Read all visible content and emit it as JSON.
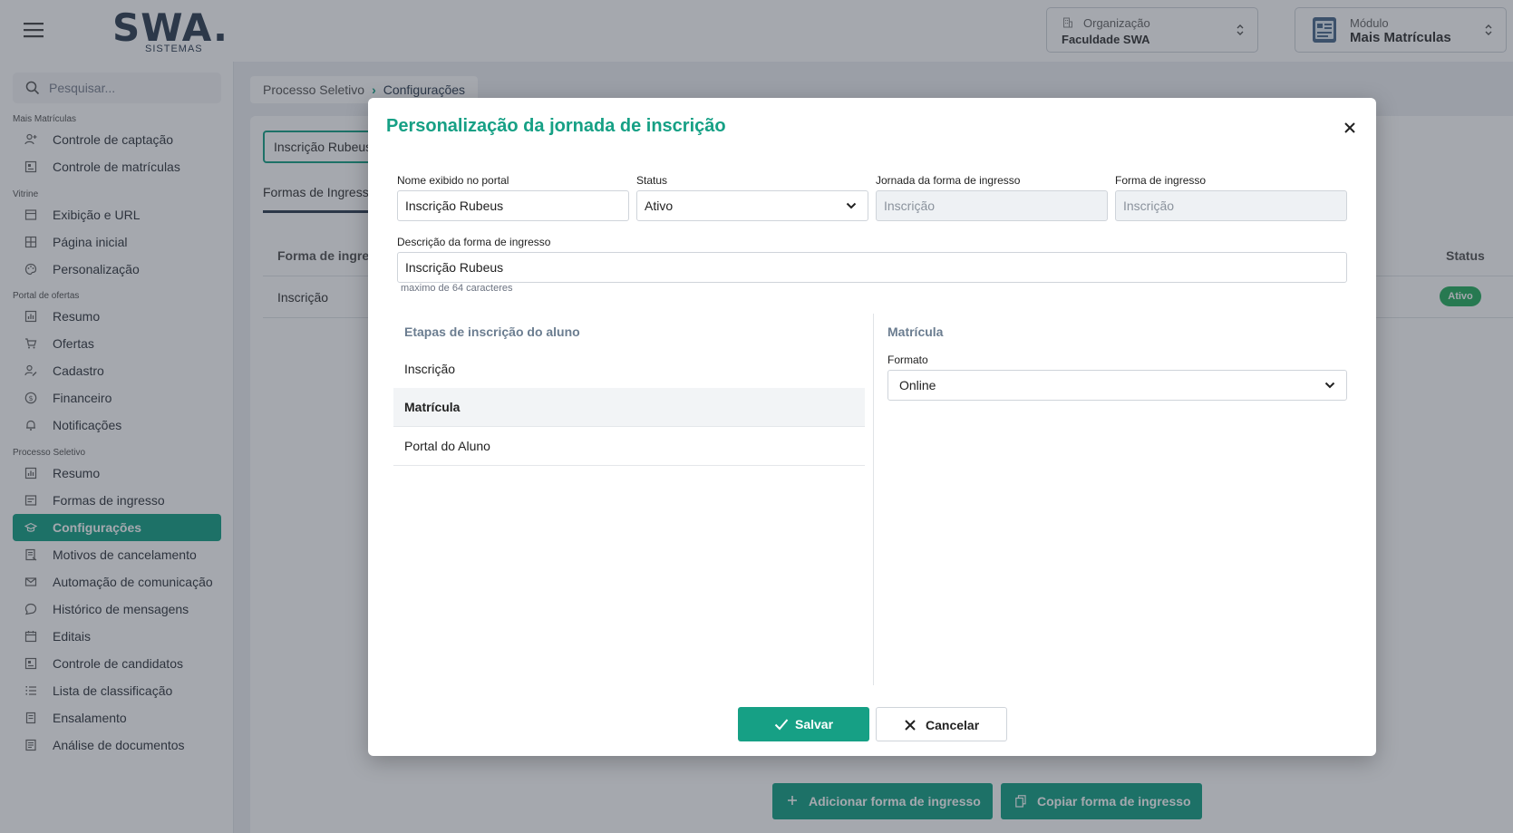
{
  "header": {
    "logo_text": "SWA.",
    "logo_sub": "SISTEMAS",
    "org_label": "Organização",
    "org_value": "Faculdade SWA",
    "module_label": "Módulo",
    "module_value": "Mais Matrículas"
  },
  "sidebar": {
    "search_placeholder": "Pesquisar...",
    "sections": [
      {
        "title": "Mais Matrículas",
        "items": [
          "Controle de captação",
          "Controle de matrículas"
        ]
      },
      {
        "title": "Vitrine",
        "items": [
          "Exibição e URL",
          "Página inicial",
          "Personalização"
        ]
      },
      {
        "title": "Portal de ofertas",
        "items": [
          "Resumo",
          "Ofertas",
          "Cadastro",
          "Financeiro",
          "Notificações"
        ]
      },
      {
        "title": "Processo Seletivo",
        "items": [
          "Resumo",
          "Formas de ingresso",
          "Configurações",
          "Motivos de cancelamento",
          "Automação de comunicação",
          "Histórico de mensagens",
          "Editais",
          "Controle de candidatos",
          "Lista de classificação",
          "Ensalamento",
          "Análise de documentos"
        ]
      }
    ],
    "active_item": "Configurações"
  },
  "breadcrumb": {
    "parent": "Processo Seletivo",
    "current": "Configurações"
  },
  "main": {
    "name_input_value": "Inscrição Rubeus",
    "tab_label": "Formas de Ingresso",
    "col_forma": "Forma de ingresso",
    "col_status": "Status",
    "row_forma": "Inscrição",
    "row_status": "Ativo",
    "add_button": "Adicionar forma de ingresso",
    "copy_button": "Copiar forma de ingresso"
  },
  "modal": {
    "title": "Personalização da jornada de inscrição",
    "nome_label": "Nome exibido no portal",
    "nome_value": "Inscrição Rubeus",
    "status_label": "Status",
    "status_value": "Ativo",
    "jornada_label": "Jornada da forma de ingresso",
    "jornada_value": "Inscrição",
    "forma_label": "Forma de ingresso",
    "forma_value": "Inscrição",
    "descricao_label": "Descrição da forma de ingresso",
    "descricao_value": "Inscrição Rubeus",
    "descricao_hint": "maximo de 64 caracteres",
    "steps_title": "Etapas de inscrição do aluno",
    "steps": [
      "Inscrição",
      "Matrícula",
      "Portal do Aluno"
    ],
    "selected_step": "Matrícula",
    "detail_title": "Matrícula",
    "formato_label": "Formato",
    "formato_value": "Online",
    "save_button": "Salvar",
    "cancel_button": "Cancelar"
  },
  "colors": {
    "accent": "#16a085",
    "badge_green": "#27ae60",
    "text_dark": "#2f3e52"
  }
}
